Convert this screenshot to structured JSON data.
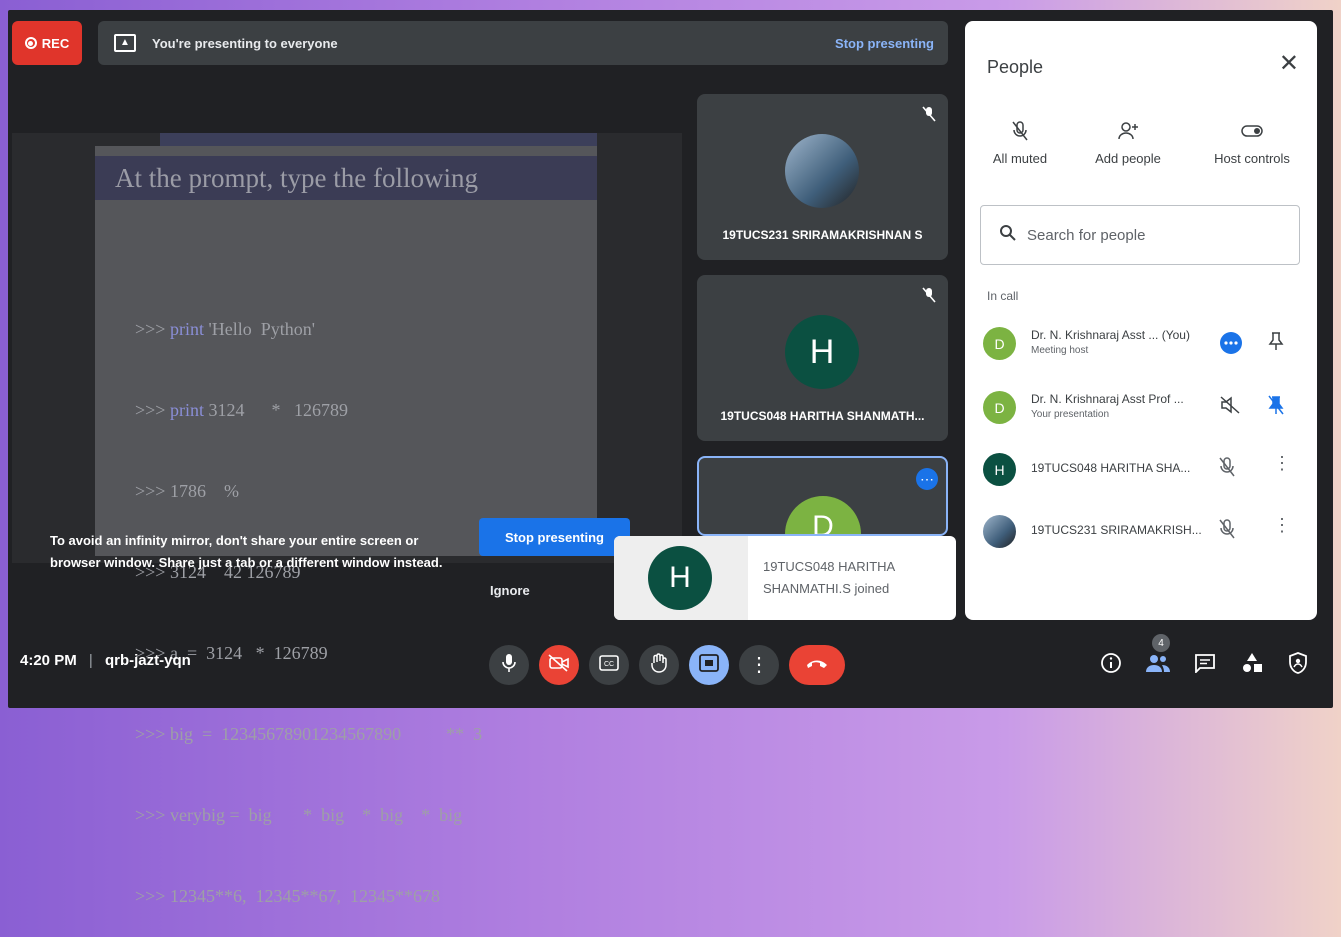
{
  "recording": {
    "label": "REC"
  },
  "presenting_bar": {
    "message": "You're presenting to everyone",
    "stop_label": "Stop presenting"
  },
  "slide": {
    "title": "At the  prompt,  type  the  following",
    "lines": [
      {
        "prompt": ">>>",
        "kw": "print",
        "rest": " 'Hello  Python'"
      },
      {
        "prompt": ">>>",
        "kw": "print",
        "rest": " 3124      *   126789"
      },
      {
        "prompt": ">>>",
        "kw": "",
        "rest": "1786    %"
      },
      {
        "prompt": ">>>",
        "kw": "",
        "rest": "3124    42 126789"
      },
      {
        "prompt": ">>>",
        "kw": "",
        "rest": "a  =  3124   *  126789"
      },
      {
        "prompt": ">>>",
        "kw": "",
        "rest": "big  =  12345678901234567890          **  3"
      },
      {
        "prompt": ">>>",
        "kw": "",
        "rest": "verybig =  big       *  big    *  big    *  big"
      },
      {
        "prompt": ">>>",
        "kw": "",
        "rest": "12345**6,  12345**67,  12345**678"
      }
    ]
  },
  "tiles": [
    {
      "name": "19TUCS231 SRIRAMAKRISHNAN S"
    },
    {
      "name": "19TUCS048 HARITHA SHANMATH...",
      "initial": "H"
    },
    {
      "initial": "D"
    }
  ],
  "infinity_warning": {
    "text": "To avoid an infinity mirror, don't share your entire screen or browser window. Share just a tab or a different window instead.",
    "stop_label": "Stop presenting",
    "ignore_label": "Ignore"
  },
  "toast": {
    "initial": "H",
    "line1": "19TUCS048 HARITHA",
    "line2": "SHANMATHI.S joined"
  },
  "people_panel": {
    "title": "People",
    "actions": [
      {
        "label": "All muted",
        "icon": "mic-off-icon"
      },
      {
        "label": "Add people",
        "icon": "add-person-icon"
      },
      {
        "label": "Host controls",
        "icon": "toggle-icon"
      }
    ],
    "search_placeholder": "Search for people",
    "section_label": "In call",
    "participants": [
      {
        "name": "Dr. N. Krishnaraj Asst ... (You)",
        "sub": "Meeting host",
        "initial": "D",
        "color": "#7cb342"
      },
      {
        "name": "Dr. N. Krishnaraj Asst Prof ...",
        "sub": "Your presentation",
        "initial": "D",
        "color": "#7cb342"
      },
      {
        "name": "19TUCS048 HARITHA SHA...",
        "sub": "",
        "initial": "H",
        "color": "#0b5041"
      },
      {
        "name": "19TUCS231 SRIRAMAKRISH...",
        "sub": "",
        "initial": "",
        "color": "#5f6368"
      }
    ]
  },
  "bottom_bar": {
    "time": "4:20 PM",
    "separator": "|",
    "meeting_code": "qrb-jazt-yqn",
    "people_count": "4"
  },
  "colors": {
    "accent": "#1a73e8",
    "danger": "#ea4335",
    "surface": "#202124",
    "tile": "#3c4043"
  }
}
